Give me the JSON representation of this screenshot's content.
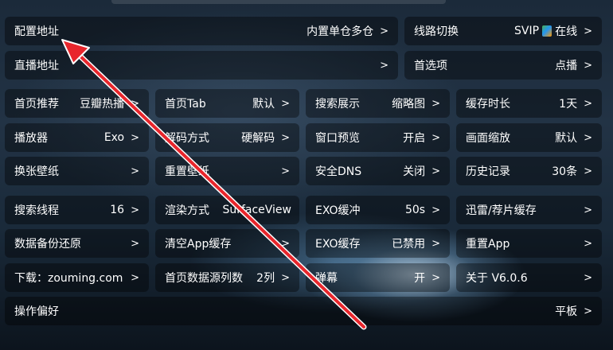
{
  "settings": {
    "config_address": {
      "label": "配置地址",
      "value": "内置单仓多仓"
    },
    "line_switch": {
      "label": "线路切换",
      "value_prefix": "SVIP",
      "value_suffix": "在线",
      "icon": "svip-badge-icon"
    },
    "live_address": {
      "label": "直播地址",
      "value": ""
    },
    "preferred": {
      "label": "首选项",
      "value": "点播"
    },
    "home_recommend": {
      "label": "首页推荐",
      "value": "豆瓣热播"
    },
    "home_tab": {
      "label": "首页Tab",
      "value": "默认"
    },
    "search_display": {
      "label": "搜索展示",
      "value": "缩略图"
    },
    "cache_duration": {
      "label": "缓存时长",
      "value": "1天"
    },
    "player": {
      "label": "播放器",
      "value": "Exo"
    },
    "decode_mode": {
      "label": "解码方式",
      "value": "硬解码"
    },
    "window_preview": {
      "label": "窗口预览",
      "value": "开启"
    },
    "screen_scale": {
      "label": "画面缩放",
      "value": "默认"
    },
    "wallpaper": {
      "label": "换张壁纸",
      "value": ""
    },
    "reset_wallpaper": {
      "label": "重置壁纸",
      "value": ""
    },
    "secure_dns": {
      "label": "安全DNS",
      "value": "关闭"
    },
    "history": {
      "label": "历史记录",
      "value": "30条"
    },
    "search_threads": {
      "label": "搜索线程",
      "value": "16"
    },
    "render_mode": {
      "label": "渲染方式",
      "value": "SurfaceView"
    },
    "exo_buffer": {
      "label": "EXO缓冲",
      "value": "50s"
    },
    "thunder_cache": {
      "label": "迅雷/荐片缓存",
      "value": ""
    },
    "backup_restore": {
      "label": "数据备份还原",
      "value": ""
    },
    "clear_cache": {
      "label": "清空App缓存",
      "value": ""
    },
    "exo_cache": {
      "label": "EXO缓存",
      "value": "已禁用"
    },
    "reset_app": {
      "label": "重置App",
      "value": ""
    },
    "download": {
      "label": "下载：zouming.com",
      "value": ""
    },
    "home_columns": {
      "label": "首页数据源列数",
      "value": "2列"
    },
    "danmaku": {
      "label": "弹幕",
      "value": "开"
    },
    "about": {
      "label": "关于  V6.0.6",
      "value": ""
    },
    "operation_pref": {
      "label": "操作偏好",
      "value": "平板"
    }
  },
  "chevron": ">",
  "colors": {
    "arrow": "#e8262c",
    "cell_bg": "rgba(0,0,0,0.38)"
  }
}
